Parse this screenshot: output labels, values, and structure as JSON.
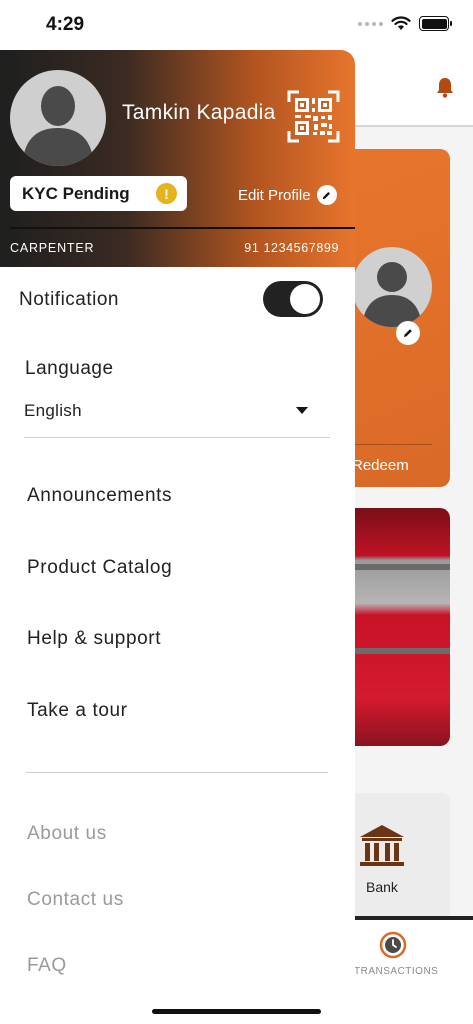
{
  "status_bar": {
    "time": "4:29"
  },
  "drawer": {
    "user_name": "Tamkin Kapadia",
    "kyc_status": "KYC Pending",
    "kyc_warning_glyph": "!",
    "edit_profile_label": "Edit Profile",
    "role": "CARPENTER",
    "phone": "91 1234567899",
    "notification_label": "Notification",
    "notification_enabled": true,
    "language_label": "Language",
    "language_value": "English",
    "menu_items": [
      "Announcements",
      "Product Catalog",
      "Help & support",
      "Take a tour"
    ],
    "secondary_items": [
      "About us",
      "Contact us",
      "FAQ"
    ]
  },
  "background": {
    "promo_redeem": "Redeem",
    "bank_label": "Bank",
    "nav_transactions_label": "TRANSACTIONS"
  },
  "colors": {
    "accent": "#e8752d",
    "header_dark": "#1f1f1f",
    "kyc_warning": "#e8b21a",
    "toggle_on": "#222222"
  },
  "icons": [
    "wifi-icon",
    "battery-icon",
    "bell-icon",
    "qr-code-icon",
    "warning-icon",
    "pencil-icon",
    "caret-down-icon",
    "bank-icon",
    "transactions-icon"
  ]
}
